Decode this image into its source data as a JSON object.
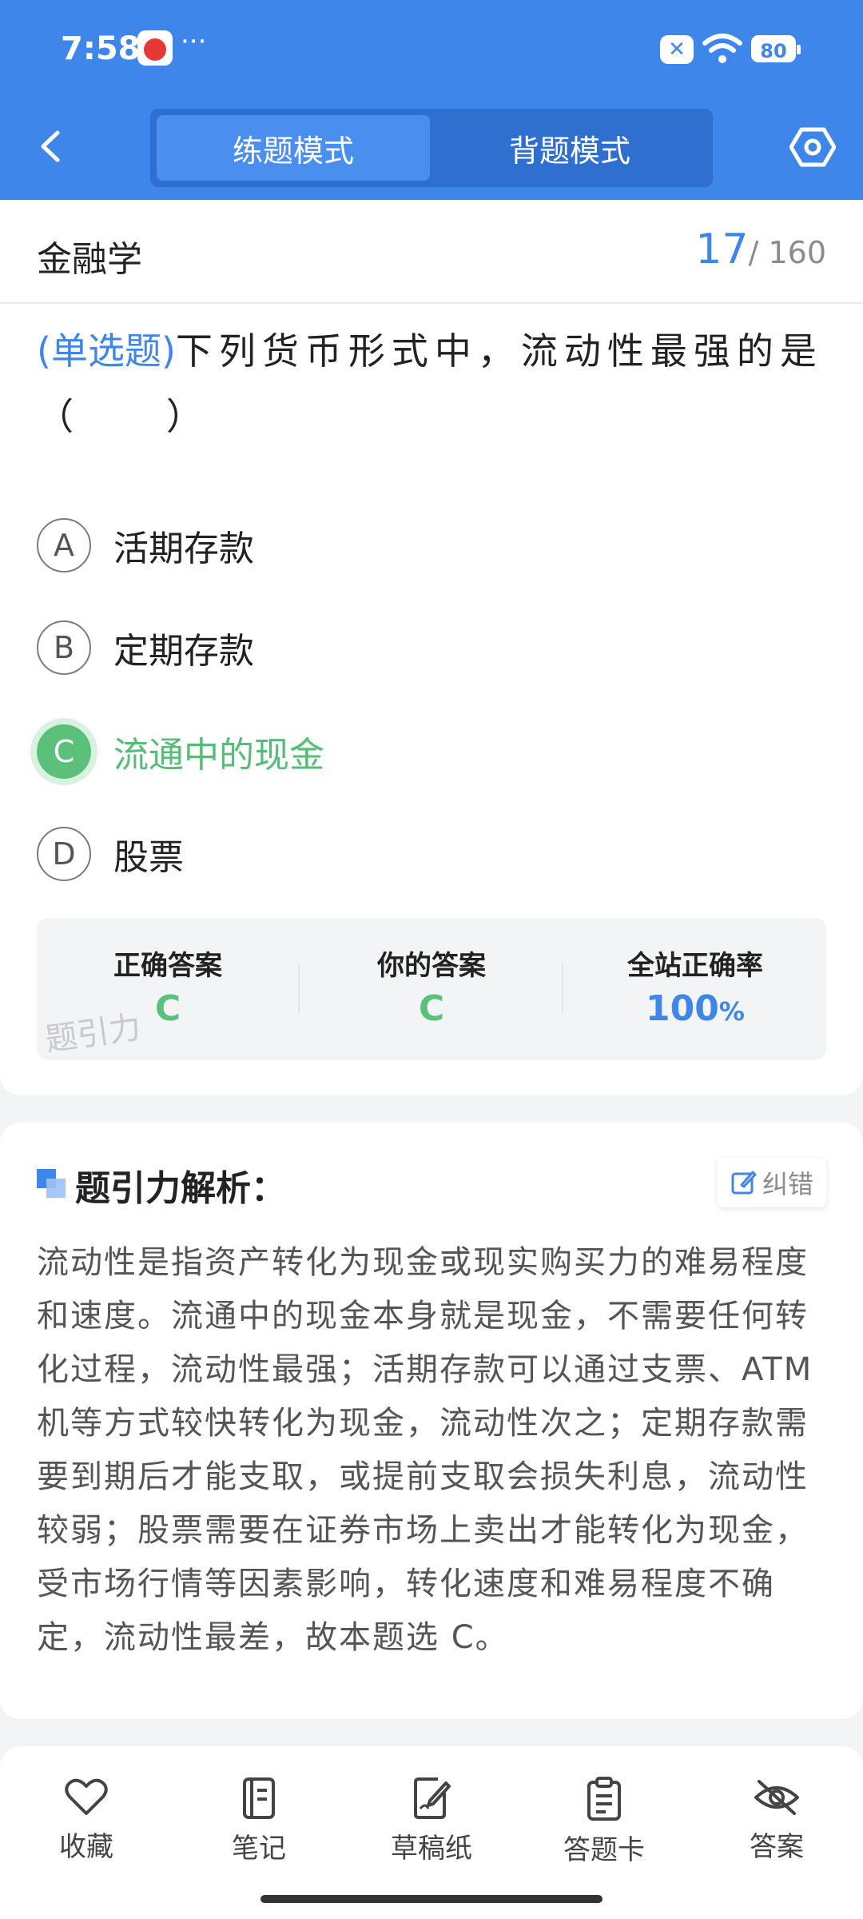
{
  "status": {
    "time": "7:58",
    "dots": "···",
    "battery": "80"
  },
  "header": {
    "mode_practice": "练题模式",
    "mode_review": "背题模式"
  },
  "subject": {
    "name": "金融学",
    "current": "17",
    "total": "/ 160"
  },
  "question": {
    "type_label": "(单选题)",
    "text": "下列货币形式中，流动性最强的是（　　）"
  },
  "options": [
    {
      "letter": "A",
      "text": "活期存款",
      "state": "normal"
    },
    {
      "letter": "B",
      "text": "定期存款",
      "state": "normal"
    },
    {
      "letter": "C",
      "text": "流通中的现金",
      "state": "correct"
    },
    {
      "letter": "D",
      "text": "股票",
      "state": "normal"
    }
  ],
  "stats": {
    "correct_label": "正确答案",
    "correct_value": "C",
    "yours_label": "你的答案",
    "yours_value": "C",
    "rate_label": "全站正确率",
    "rate_value": "100",
    "rate_unit": "%",
    "watermark": "题引力"
  },
  "analysis": {
    "title": "题引力解析：",
    "correction_label": "纠错",
    "text": "流动性是指资产转化为现金或现实购买力的难易程度和速度。流通中的现金本身就是现金，不需要任何转化过程，流动性最强；活期存款可以通过支票、ATM机等方式较快转化为现金，流动性次之；定期存款需要到期后才能支取，或提前支取会损失利息，流动性较弱；股票需要在证券市场上卖出才能转化为现金，受市场行情等因素影响，转化速度和难易程度不确定，流动性最差，故本题选 C。"
  },
  "bottom_nav": {
    "favorite": "收藏",
    "notes": "笔记",
    "scratch": "草稿纸",
    "answer_card": "答题卡",
    "answer": "答案"
  },
  "colors": {
    "primary": "#3f86ea",
    "correct": "#5ac07a",
    "background": "#f3f4f6"
  }
}
